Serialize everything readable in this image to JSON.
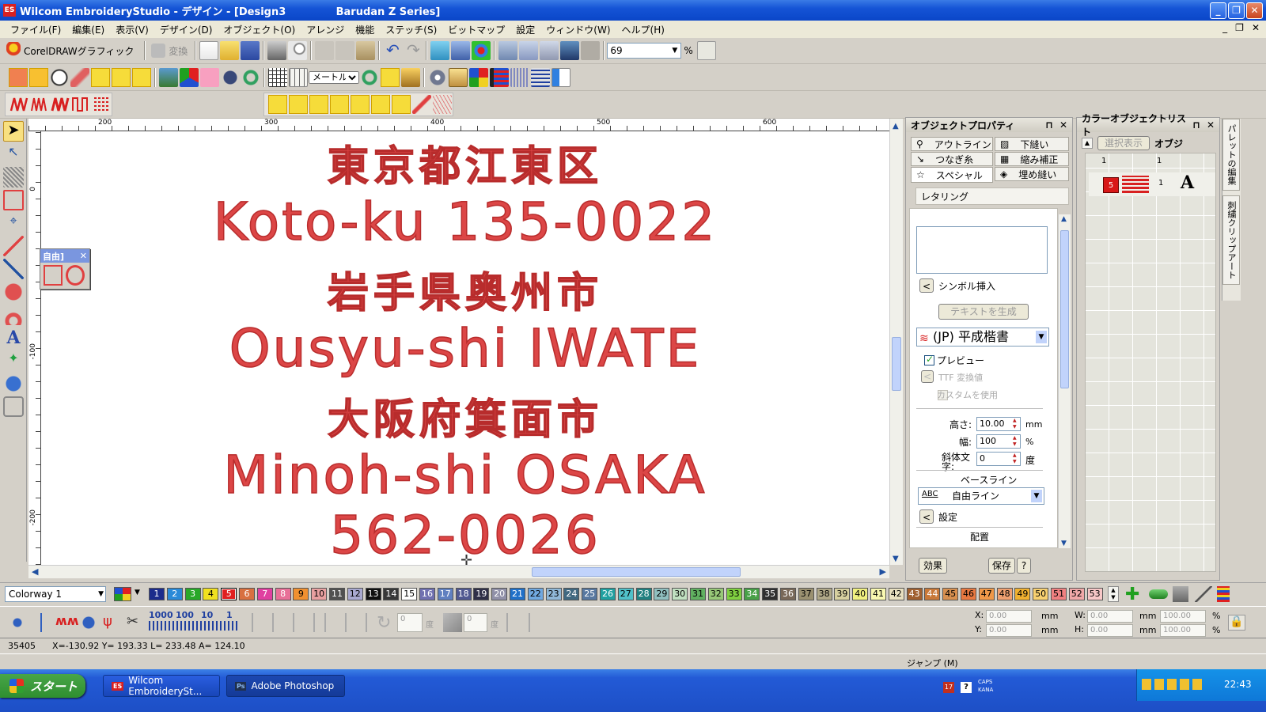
{
  "window": {
    "app_icon": "ES",
    "title": "Wilcom EmbroideryStudio - デザイン - [Design3              Barudan Z Series]",
    "minimize": "_",
    "restore": "❐",
    "close": "✕"
  },
  "menu": [
    "ファイル(F)",
    "編集(E)",
    "表示(V)",
    "デザイン(D)",
    "オブジェクト(O)",
    "アレンジ",
    "機能",
    "ステッチ(S)",
    "ビットマップ",
    "設定",
    "ウィンドウ(W)",
    "ヘルプ(H)"
  ],
  "mdi_buttons": [
    "_",
    "❐",
    "✕"
  ],
  "toolbar": {
    "coreldraw_label": "CorelDRAWグラフィック",
    "convert_label": "変換",
    "zoom_value": "69",
    "zoom_unit": "%",
    "measure_mode": "メートル法"
  },
  "float_palette": {
    "title": "自由]",
    "close": "✕"
  },
  "rulers": {
    "h": [
      "200",
      "300",
      "400",
      "500",
      "600"
    ],
    "v": [
      "0",
      "-100",
      "-200"
    ]
  },
  "canvas_lines": [
    {
      "text": "東京都江東区",
      "kind": "ja"
    },
    {
      "text": "Koto-ku 135-0022",
      "kind": "en"
    },
    {
      "text": "岩手県奥州市",
      "kind": "ja"
    },
    {
      "text": "Ousyu-shi IWATE",
      "kind": "en"
    },
    {
      "text": "大阪府箕面市",
      "kind": "ja"
    },
    {
      "text": "Minoh-shi OSAKA",
      "kind": "en"
    },
    {
      "text": "562-0026",
      "kind": "en"
    }
  ],
  "props_panel": {
    "title": "オブジェクトプロパティ",
    "pin": "⊓",
    "close": "✕",
    "tabs": {
      "outline": "アウトライン",
      "underlay": "下縫い",
      "connector": "つなぎ糸",
      "pull_comp": "縮み補正",
      "special": "スペシャル",
      "fill": "埋め縫い"
    },
    "section": "レタリング",
    "insert_symbol": "シンボル挿入",
    "generate_text": "テキストを生成",
    "font": "(JP) 平成楷書",
    "preview": "プレビュー",
    "ttf_convert": "TTF 変換値",
    "use_custom": "カスタムを使用",
    "height_label": "高さ:",
    "height_value": "10.00",
    "height_unit": "mm",
    "width_label": "幅:",
    "width_value": "100",
    "width_unit": "%",
    "italic_label": "斜体文字:",
    "italic_value": "0",
    "italic_unit": "度",
    "baseline_label": "ベースライン",
    "baseline_icon": "ABC",
    "baseline_value": "自由ライン",
    "settings": "設定",
    "arrange_label": "配置",
    "effects": "効果",
    "save": "保存",
    "help": "?",
    "expand_arrow": "<"
  },
  "color_list": {
    "title": "カラーオブジェクトリスト",
    "show_selected": "選択表示",
    "objects_label": "オブジ",
    "header_col1": "1",
    "header_col2": "1",
    "row_color_index": "5",
    "row_count": "1",
    "row_letter": "A"
  },
  "side_tabs": [
    "パレットの編集",
    "刺繍クリップアート"
  ],
  "colorway": {
    "name": "Colorway 1",
    "swatches": [
      {
        "n": "1",
        "bg": "#1c2c8c",
        "fg": "#fff"
      },
      {
        "n": "2",
        "bg": "#2a8ad8",
        "fg": "#fff"
      },
      {
        "n": "3",
        "bg": "#28a828",
        "fg": "#fff"
      },
      {
        "n": "4",
        "bg": "#f0e020",
        "fg": "#000"
      },
      {
        "n": "5",
        "bg": "#e02020",
        "fg": "#fff"
      },
      {
        "n": "6",
        "bg": "#d87040",
        "fg": "#fff"
      },
      {
        "n": "7",
        "bg": "#e040a0",
        "fg": "#fff"
      },
      {
        "n": "8",
        "bg": "#e87098",
        "fg": "#fff"
      },
      {
        "n": "9",
        "bg": "#f09030",
        "fg": "#000"
      },
      {
        "n": "10",
        "bg": "#e8a0a0",
        "fg": "#000"
      },
      {
        "n": "11",
        "bg": "#505050",
        "fg": "#fff"
      },
      {
        "n": "12",
        "bg": "#a8a8d0",
        "fg": "#000"
      },
      {
        "n": "13",
        "bg": "#101010",
        "fg": "#fff"
      },
      {
        "n": "14",
        "bg": "#383838",
        "fg": "#fff"
      },
      {
        "n": "15",
        "bg": "#ffffff",
        "fg": "#000"
      },
      {
        "n": "16",
        "bg": "#7070b0",
        "fg": "#fff"
      },
      {
        "n": "17",
        "bg": "#6080c0",
        "fg": "#fff"
      },
      {
        "n": "18",
        "bg": "#505890",
        "fg": "#fff"
      },
      {
        "n": "19",
        "bg": "#303048",
        "fg": "#fff"
      },
      {
        "n": "20",
        "bg": "#9090a8",
        "fg": "#fff"
      },
      {
        "n": "21",
        "bg": "#2070c8",
        "fg": "#fff"
      },
      {
        "n": "22",
        "bg": "#70a8e0",
        "fg": "#000"
      },
      {
        "n": "23",
        "bg": "#90b8d8",
        "fg": "#000"
      },
      {
        "n": "24",
        "bg": "#406880",
        "fg": "#fff"
      },
      {
        "n": "25",
        "bg": "#5878a0",
        "fg": "#fff"
      },
      {
        "n": "26",
        "bg": "#20a0a0",
        "fg": "#fff"
      },
      {
        "n": "27",
        "bg": "#50c0c8",
        "fg": "#000"
      },
      {
        "n": "28",
        "bg": "#208080",
        "fg": "#fff"
      },
      {
        "n": "29",
        "bg": "#90c0c0",
        "fg": "#000"
      },
      {
        "n": "30",
        "bg": "#c0e0c0",
        "fg": "#000"
      },
      {
        "n": "31",
        "bg": "#60b060",
        "fg": "#000"
      },
      {
        "n": "32",
        "bg": "#98c878",
        "fg": "#000"
      },
      {
        "n": "33",
        "bg": "#80d040",
        "fg": "#000"
      },
      {
        "n": "34",
        "bg": "#48a048",
        "fg": "#fff"
      },
      {
        "n": "35",
        "bg": "#303030",
        "fg": "#fff"
      },
      {
        "n": "36",
        "bg": "#786858",
        "fg": "#fff"
      },
      {
        "n": "37",
        "bg": "#9a9070",
        "fg": "#000"
      },
      {
        "n": "38",
        "bg": "#b0a888",
        "fg": "#000"
      },
      {
        "n": "39",
        "bg": "#d8d0a0",
        "fg": "#000"
      },
      {
        "n": "40",
        "bg": "#f0f080",
        "fg": "#000"
      },
      {
        "n": "41",
        "bg": "#f8f8b0",
        "fg": "#000"
      },
      {
        "n": "42",
        "bg": "#e8e0c0",
        "fg": "#000"
      },
      {
        "n": "43",
        "bg": "#a06030",
        "fg": "#fff"
      },
      {
        "n": "44",
        "bg": "#c87838",
        "fg": "#fff"
      },
      {
        "n": "45",
        "bg": "#d89050",
        "fg": "#000"
      },
      {
        "n": "46",
        "bg": "#e87840",
        "fg": "#000"
      },
      {
        "n": "47",
        "bg": "#f09848",
        "fg": "#000"
      },
      {
        "n": "48",
        "bg": "#f0a070",
        "fg": "#000"
      },
      {
        "n": "49",
        "bg": "#f0b030",
        "fg": "#000"
      },
      {
        "n": "50",
        "bg": "#f8d070",
        "fg": "#000"
      },
      {
        "n": "51",
        "bg": "#f08080",
        "fg": "#000"
      },
      {
        "n": "52",
        "bg": "#f0a8a8",
        "fg": "#000"
      },
      {
        "n": "53",
        "bg": "#f8c8c8",
        "fg": "#000"
      }
    ]
  },
  "bottom": {
    "stitch_values": [
      "1000",
      "100",
      "10",
      "1"
    ],
    "field1": "0",
    "unit1": "度",
    "field2": "0",
    "unit2": "度",
    "x_label": "X:",
    "x_value": "0.00",
    "x_unit": "mm",
    "y_label": "Y:",
    "y_value": "0.00",
    "y_unit": "mm",
    "w_label": "W:",
    "w_value": "0.00",
    "w_unit": "mm",
    "h_label": "H:",
    "h_value": "0.00",
    "h_unit": "mm",
    "wp_value": "100.00",
    "wp_unit": "%",
    "hp_value": "100.00",
    "hp_unit": "%"
  },
  "status": {
    "stitch_count": "35405",
    "coords": "X=-130.92 Y= 193.33 L= 233.48 A= 124.10",
    "jump": "ジャンプ (M)"
  },
  "taskbar": {
    "start": "スタート",
    "tasks": [
      {
        "label": "Wilcom EmbroiderySt...",
        "icon": "ES"
      },
      {
        "label": "Adobe Photoshop",
        "icon": "Ps"
      }
    ],
    "tray_caps": "CAPS",
    "tray_kana": "KANA",
    "tray_num": "17",
    "clock": "22:43"
  }
}
